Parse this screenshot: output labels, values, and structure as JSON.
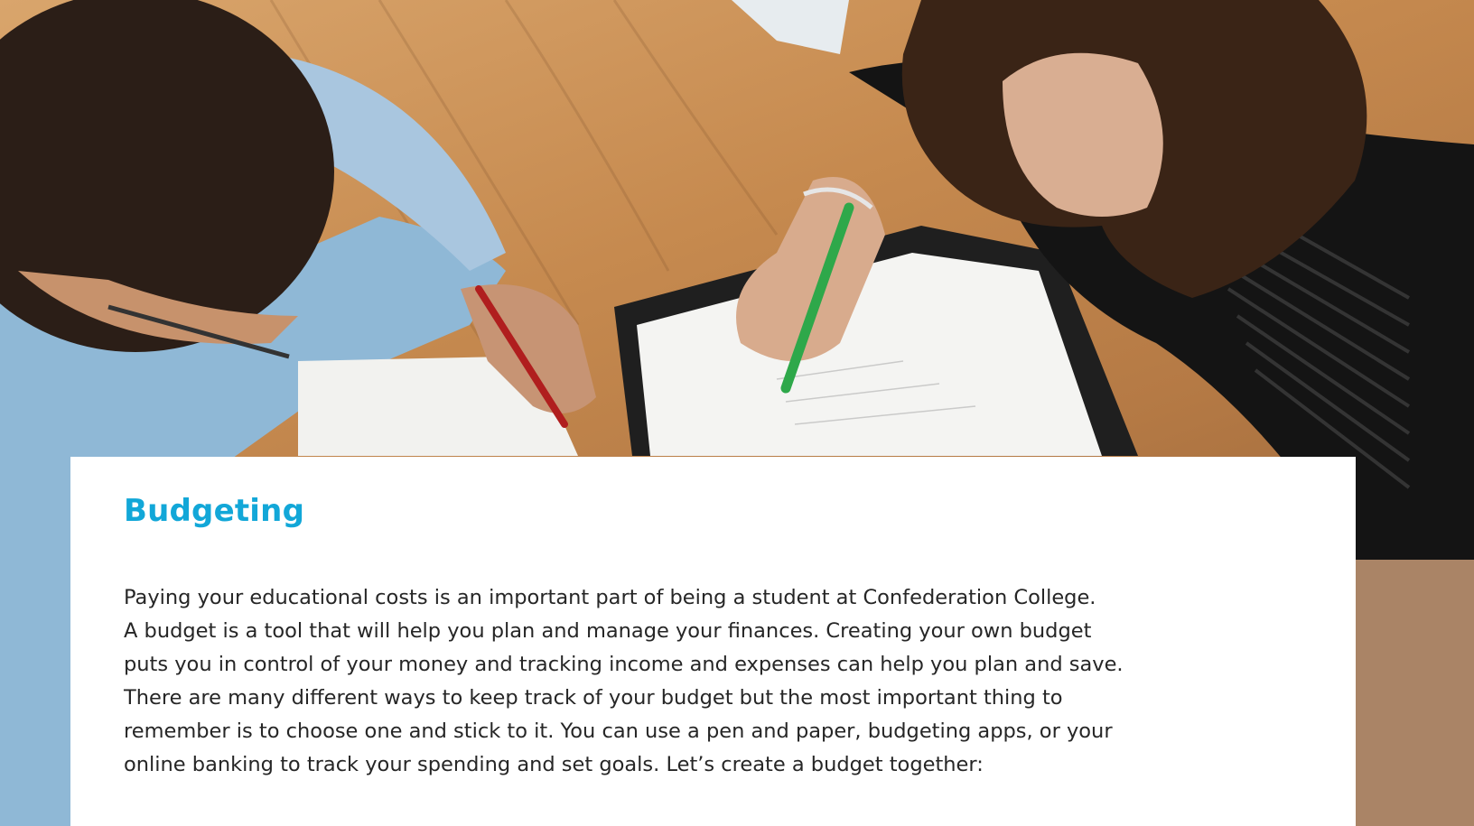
{
  "hero": {
    "image": "photo: two students writing at a wooden table with pens and paper"
  },
  "section": {
    "title": "Budgeting",
    "body": "Paying your educational costs is an important part of being a student at Confederation College.\nA budget is a tool that will help you plan and manage your finances. Creating your own budget\nputs you in control of your money and tracking income and expenses can help you plan and save.\nThere are many different ways to keep track of your budget but the most important thing to\nremember is to choose one and stick to it. You can use a pen and paper, budgeting apps, or your\nonline banking to track your spending and set goals. Let’s create a budget together:"
  },
  "colors": {
    "title": "#12a7d8",
    "body_text": "#262626",
    "table_wood": "#c68a4f"
  }
}
